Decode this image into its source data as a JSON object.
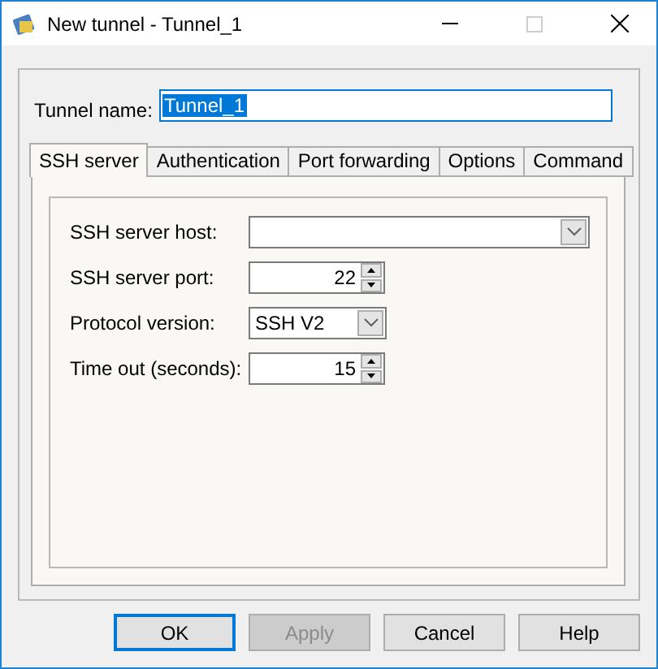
{
  "window": {
    "title": "New tunnel - Tunnel_1"
  },
  "tunnel_name": {
    "label": "Tunnel name:",
    "value": "Tunnel_1",
    "selected": true
  },
  "tabs": [
    {
      "label": "SSH server",
      "selected": true
    },
    {
      "label": "Authentication",
      "selected": false
    },
    {
      "label": "Port forwarding",
      "selected": false
    },
    {
      "label": "Options",
      "selected": false
    },
    {
      "label": "Command",
      "selected": false
    }
  ],
  "fields": [
    {
      "kind": "combo",
      "label": "SSH server host:"
    },
    {
      "kind": "spin",
      "label": "SSH server port:",
      "value": "22"
    },
    {
      "kind": "dropdown",
      "label": "Protocol version:",
      "value": "SSH V2"
    },
    {
      "kind": "spin",
      "label": "Time out (seconds):",
      "value": "15"
    }
  ],
  "buttons": [
    {
      "label": "OK",
      "default": true,
      "disabled": false
    },
    {
      "label": "Apply",
      "default": false,
      "disabled": true
    },
    {
      "label": "Cancel",
      "default": false,
      "disabled": false
    },
    {
      "label": "Help",
      "default": false,
      "disabled": false
    }
  ]
}
